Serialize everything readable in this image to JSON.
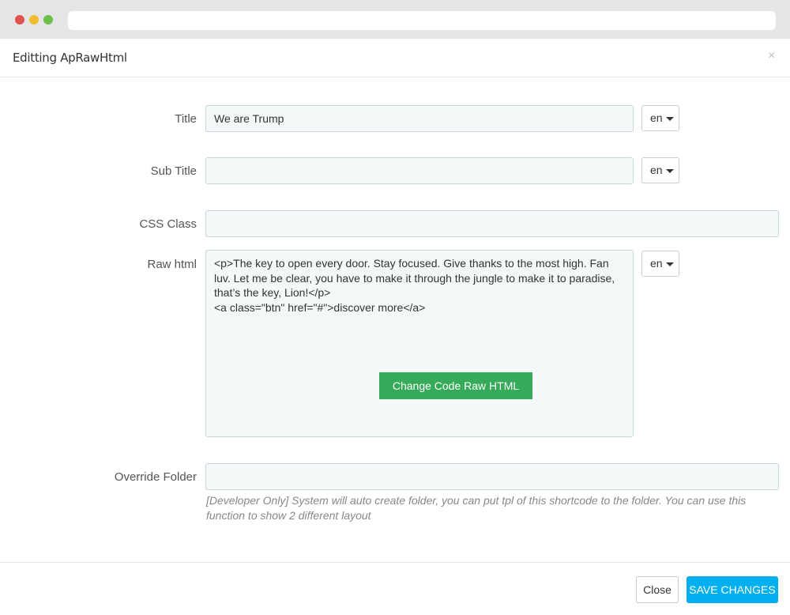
{
  "modal": {
    "title": "Editting ApRawHtml",
    "close_symbol": "×"
  },
  "form": {
    "title": {
      "label": "Title",
      "value": "We are Trump",
      "lang": "en"
    },
    "subtitle": {
      "label": "Sub Title",
      "value": "",
      "lang": "en"
    },
    "css_class": {
      "label": "CSS Class",
      "value": ""
    },
    "raw_html": {
      "label": "Raw html",
      "value": "<p>The key to open every door. Stay focused. Give thanks to the most high. Fan luv. Let me be clear, you have to make it through the jungle to make it to paradise, that’s the key, Lion!</p>\n<a class=\"btn\" href=\"#\">discover more</a>",
      "lang": "en",
      "change_button": "Change Code Raw HTML"
    },
    "override_folder": {
      "label": "Override Folder",
      "value": "",
      "help": "[Developer Only] System will auto create folder, you can put tpl of this shortcode to the folder. You can use this function to show 2 different layout"
    }
  },
  "footer": {
    "close_label": "Close",
    "save_label": "SAVE CHANGES"
  },
  "colors": {
    "save": "#00aff0",
    "change_button": "#35aa58",
    "input_bg": "#f5f8f9"
  }
}
